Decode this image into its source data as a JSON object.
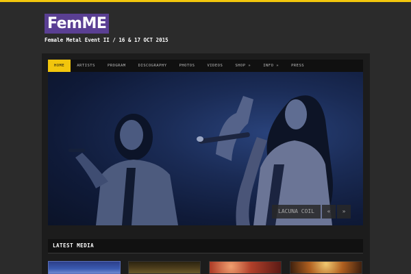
{
  "site": {
    "logo": "FemME",
    "tagline": "Female Metal Event II / 16 & 17 OCT 2015"
  },
  "nav": {
    "items": [
      {
        "label": "HOME",
        "active": true
      },
      {
        "label": "ARTISTS"
      },
      {
        "label": "PROGRAM"
      },
      {
        "label": "DISCOGRAPHY"
      },
      {
        "label": "PHOTOS"
      },
      {
        "label": "VIDEOS"
      },
      {
        "label": "SHOP »"
      },
      {
        "label": "INFO »"
      },
      {
        "label": "PRESS"
      }
    ]
  },
  "slider": {
    "caption": "LACUNA COIL",
    "prev": "«",
    "next": "»"
  },
  "latest_media": {
    "title": "LATEST MEDIA"
  },
  "colors": {
    "accent": "#f2c60d",
    "logo_bg": "#5a3f93",
    "page_bg": "#2b2b2b"
  }
}
